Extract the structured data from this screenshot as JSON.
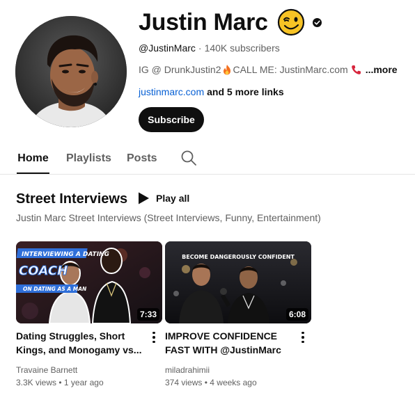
{
  "channel": {
    "name": "Justin Marc",
    "handle": "@JustinMarc",
    "separator": "·",
    "subscribers": "140K subscribers",
    "description_part1": "IG @ DrunkJustin2",
    "description_part2": "CALL ME: JustinMarc.com",
    "more_label": "...more",
    "link_text": "justinmarc.com",
    "more_links_text": "and 5 more links",
    "subscribe_label": "Subscribe",
    "emoji_icon": "winking-face-emoji",
    "verified_icon": "verified-checkmark-icon"
  },
  "tabs": [
    {
      "label": "Home",
      "active": true
    },
    {
      "label": "Playlists",
      "active": false
    },
    {
      "label": "Posts",
      "active": false
    }
  ],
  "shelf": {
    "title": "Street Interviews",
    "play_all_label": "Play all",
    "description": "Justin Marc Street Interviews (Street Interviews, Funny, Entertainment)"
  },
  "videos": [
    {
      "title": "Dating Struggles, Short Kings, and Monogamy vs...",
      "duration": "7:33",
      "channel": "Travaine Barnett",
      "views": "3.3K views",
      "age": "1 year ago",
      "thumb_text_1": "INTERVIEWING A DATING",
      "thumb_text_2": "COACH",
      "thumb_text_3": "ON DATING AS A MAN"
    },
    {
      "title": "IMPROVE CONFIDENCE FAST WITH @JustinMarc",
      "duration": "6:08",
      "channel": "miladrahimii",
      "views": "374 views",
      "age": "4 weeks ago",
      "thumb_text_1": "BECOME DANGEROUSLY CONFIDENT"
    }
  ],
  "colors": {
    "link": "#065fd4",
    "primary_text": "#0f0f0f",
    "secondary_text": "#606060",
    "subscribe_bg": "#0f0f0f",
    "thumb_banner": "#2f6fd9"
  }
}
